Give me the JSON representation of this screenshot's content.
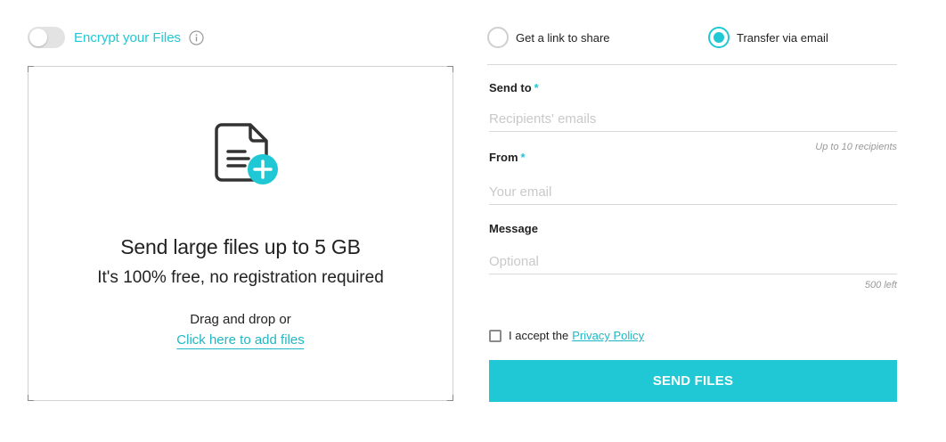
{
  "encrypt": {
    "label": "Encrypt your Files",
    "enabled": false,
    "info_icon": "info-icon"
  },
  "dropzone": {
    "icon": "file-add-icon",
    "title": "Send large files up to 5 GB",
    "subtitle": "It's 100% free, no registration required",
    "hint": "Drag and drop or",
    "add_link": "Click here to add files"
  },
  "share_mode": {
    "options": [
      {
        "label": "Get a link to share",
        "selected": false
      },
      {
        "label": "Transfer via email",
        "selected": true
      }
    ]
  },
  "form": {
    "send_to": {
      "label": "Send to",
      "required_mark": "*",
      "value": "",
      "placeholder": "Recipients' emails",
      "hint": "Up to 10 recipients"
    },
    "from": {
      "label": "From",
      "required_mark": "*",
      "value": "",
      "placeholder": "Your email"
    },
    "message": {
      "label": "Message",
      "value": "",
      "placeholder": "Optional",
      "hint": "500 left"
    }
  },
  "privacy": {
    "checked": false,
    "text": "I accept the",
    "link": "Privacy Policy"
  },
  "submit": {
    "label": "SEND FILES"
  },
  "colors": {
    "accent": "#1fc8d4",
    "link": "#1fb8c4",
    "text": "#222222",
    "placeholder": "#c9c9c9"
  }
}
